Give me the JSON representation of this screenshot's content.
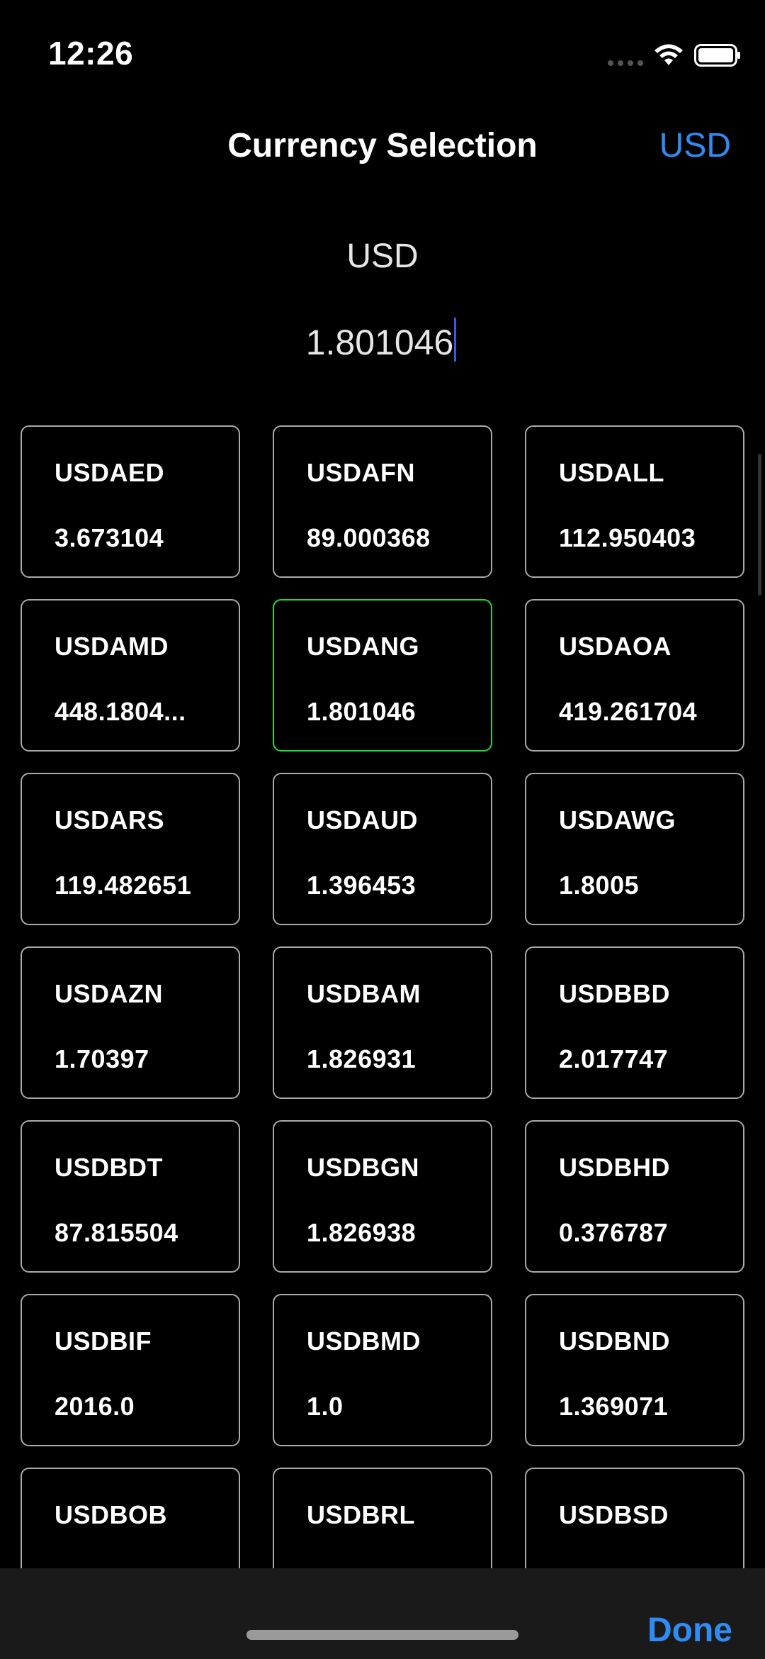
{
  "status_bar": {
    "time": "12:26"
  },
  "nav": {
    "title": "Currency Selection",
    "action_label": "USD"
  },
  "header": {
    "base_currency": "USD",
    "amount_value": "1.801046"
  },
  "cards": [
    {
      "code": "USDAED",
      "rate": "3.673104",
      "selected": false
    },
    {
      "code": "USDAFN",
      "rate": "89.000368",
      "selected": false
    },
    {
      "code": "USDALL",
      "rate": "112.950403",
      "selected": false
    },
    {
      "code": "USDAMD",
      "rate": "448.1804...",
      "selected": false
    },
    {
      "code": "USDANG",
      "rate": "1.801046",
      "selected": true
    },
    {
      "code": "USDAOA",
      "rate": "419.261704",
      "selected": false
    },
    {
      "code": "USDARS",
      "rate": "119.482651",
      "selected": false
    },
    {
      "code": "USDAUD",
      "rate": "1.396453",
      "selected": false
    },
    {
      "code": "USDAWG",
      "rate": "1.8005",
      "selected": false
    },
    {
      "code": "USDAZN",
      "rate": "1.70397",
      "selected": false
    },
    {
      "code": "USDBAM",
      "rate": "1.826931",
      "selected": false
    },
    {
      "code": "USDBBD",
      "rate": "2.017747",
      "selected": false
    },
    {
      "code": "USDBDT",
      "rate": "87.815504",
      "selected": false
    },
    {
      "code": "USDBGN",
      "rate": "1.826938",
      "selected": false
    },
    {
      "code": "USDBHD",
      "rate": "0.376787",
      "selected": false
    },
    {
      "code": "USDBIF",
      "rate": "2016.0",
      "selected": false
    },
    {
      "code": "USDBMD",
      "rate": "1.0",
      "selected": false
    },
    {
      "code": "USDBND",
      "rate": "1.369071",
      "selected": false
    },
    {
      "code": "USDBOB",
      "rate": "",
      "selected": false
    },
    {
      "code": "USDBRL",
      "rate": "",
      "selected": false
    },
    {
      "code": "USDBSD",
      "rate": "",
      "selected": false
    }
  ],
  "toolbar": {
    "done_label": "Done"
  },
  "colors": {
    "accent": "#2f8cf2",
    "selected_border": "#25d93a",
    "card_border": "#a9a9a9",
    "background": "#000000",
    "toolbar_background": "#1a1a1a"
  },
  "icons": {
    "signal": "cellular-signal-icon",
    "wifi": "wifi-icon",
    "battery": "battery-icon"
  }
}
